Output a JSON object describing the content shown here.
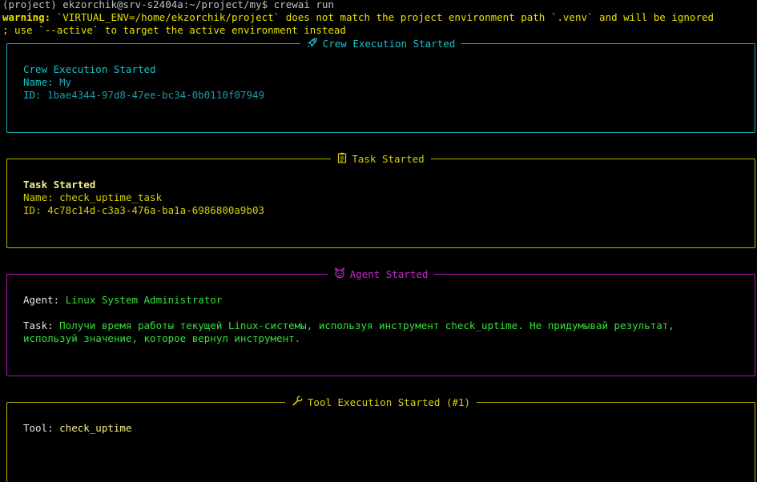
{
  "terminal": {
    "prompt_line": "(project) ekzorchik@srv-s2404a:~/project/my$ crewai run",
    "warning_label": "warning:",
    "warning_text": " `VIRTUAL_ENV=/home/ekzorchik/project` does not match the project environment path `.venv` and will be ignored",
    "warning_cont": "; use `--active` to target the active environment instead"
  },
  "panels": {
    "crew": {
      "title": "Crew Execution Started",
      "icon": "rocket-icon",
      "color": "#17c3c8",
      "heading": "Crew Execution Started",
      "name_label": "Name: ",
      "name_value": "My",
      "id_label": "ID: ",
      "id_value": "1bae4344-97d8-47ee-bc34-0b0110f07949"
    },
    "task": {
      "title": "Task Started",
      "icon": "clipboard-icon",
      "color": "#d8d000",
      "heading": "Task Started",
      "name_label": "Name: ",
      "name_value": "check_uptime_task",
      "id_label": "ID: ",
      "id_value": "4c78c14d-c3a3-476a-ba1a-6986800a9b03"
    },
    "agent": {
      "title": "Agent Started",
      "icon": "agent-icon",
      "color": "#cc22cc",
      "agent_label": "Agent: ",
      "agent_value": "Linux System Administrator",
      "task_label": "Task: ",
      "task_value_1": "Получи время работы текущей Linux-системы, используя инструмент check_uptime. Не придумывай результат,",
      "task_value_2": "используй значение, которое вернул инструмент."
    },
    "tool": {
      "title": "Tool Execution Started (#1)",
      "icon": "wrench-icon",
      "color": "#d8d000",
      "tool_label": "Tool: ",
      "tool_value": "check_uptime"
    }
  }
}
